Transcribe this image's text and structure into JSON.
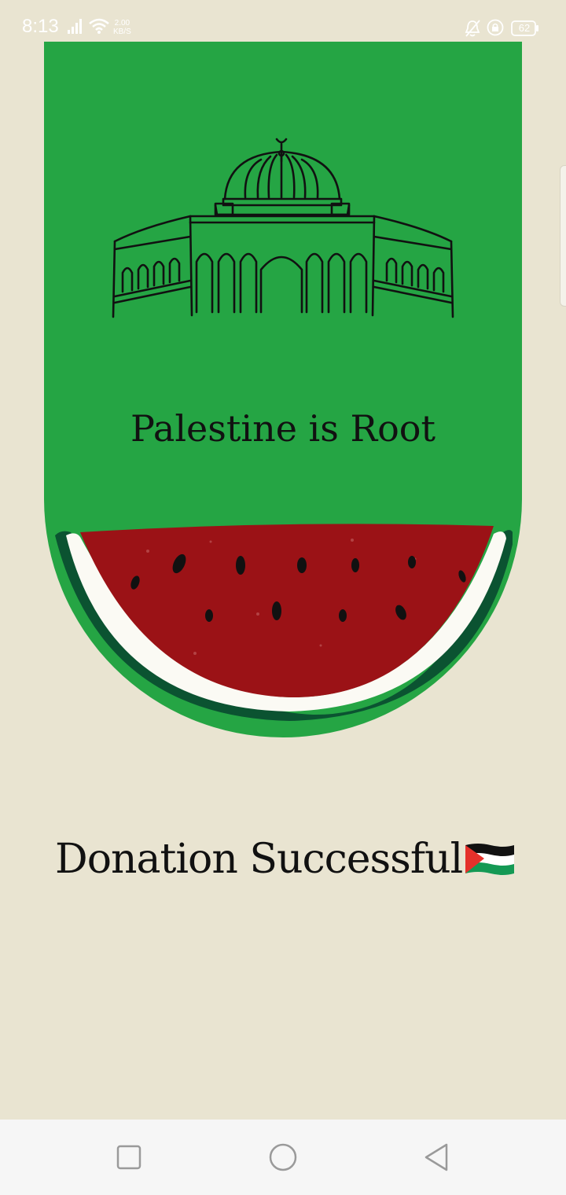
{
  "status_bar": {
    "time": "8:13",
    "speed_value": "2.00",
    "speed_unit": "KB/S",
    "battery": "62"
  },
  "banner": {
    "title": "Palestine is Root",
    "background_color": "#25a544"
  },
  "message": {
    "text": "Donation Successful"
  },
  "icons": {
    "mosque": "al-aqsa-dome-icon",
    "watermelon": "watermelon-icon",
    "flag": "palestine-flag-icon"
  },
  "colors": {
    "page_background": "#e9e4d1",
    "watermelon_red": "#9b1216",
    "rind_dark": "#0b5331",
    "flag_red": "#e4312b",
    "flag_green": "#149954"
  }
}
